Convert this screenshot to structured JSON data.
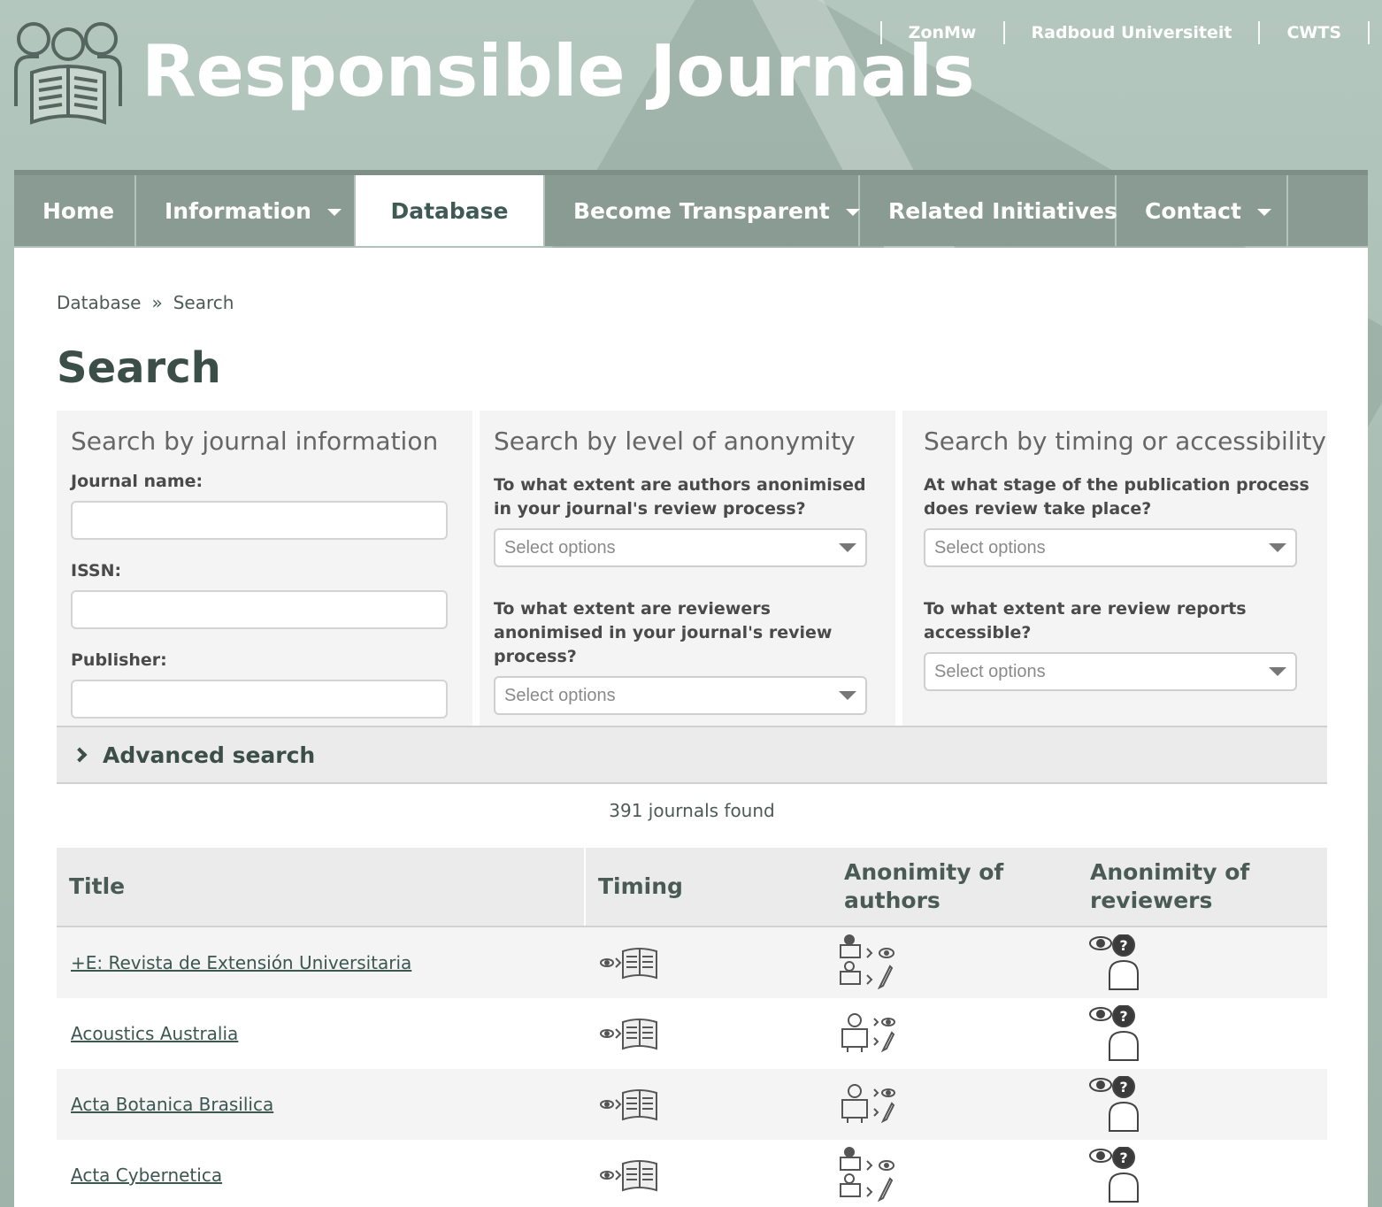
{
  "site": {
    "title": "Responsible Journals",
    "top_links": [
      "ZonMw",
      "Radboud Universiteit",
      "CWTS"
    ]
  },
  "nav": [
    {
      "label": "Home",
      "dropdown": false,
      "active": false
    },
    {
      "label": "Information",
      "dropdown": true,
      "active": false
    },
    {
      "label": "Database",
      "dropdown": false,
      "active": true
    },
    {
      "label": "Become Transparent",
      "dropdown": true,
      "active": false
    },
    {
      "label": "Related Initiatives",
      "dropdown": false,
      "active": false
    },
    {
      "label": "Contact",
      "dropdown": true,
      "active": false
    }
  ],
  "breadcrumb": {
    "items": [
      "Database",
      "Search"
    ],
    "separator": "»"
  },
  "page_title": "Search",
  "filters": {
    "journal": {
      "heading": "Search by journal information",
      "name_label": "Journal name:",
      "issn_label": "ISSN:",
      "publisher_label": "Publisher:"
    },
    "anonymity": {
      "heading": "Search by level of anonymity",
      "authors_label": "To what extent are authors anonimised in your journal's review process?",
      "authors_placeholder": "Select options",
      "reviewers_label": "To what extent are reviewers anonimised in your journal's review process?",
      "reviewers_placeholder": "Select options"
    },
    "timing": {
      "heading": "Search by timing or accessibility",
      "stage_label": "At what stage of the publication process does review take place?",
      "stage_placeholder": "Select options",
      "reports_label": "To what extent are review reports accessible?",
      "reports_placeholder": "Select options"
    }
  },
  "advanced_search": "Advanced search",
  "results_count": "391 journals found",
  "table": {
    "headers": [
      "Title",
      "Timing",
      "Anonimity of authors",
      "Anonimity of reviewers"
    ],
    "rows": [
      {
        "title": "+E: Revista de Extensión Universitaria",
        "timing_icon": "eye-before-publication-icon",
        "authors_icon": "author-known-to-reviewer-and-editor-icon",
        "reviewers_icon": "reviewer-anonymous-icon"
      },
      {
        "title": "Acoustics Australia",
        "timing_icon": "eye-before-publication-icon",
        "authors_icon": "author-anonymous-to-both-icon",
        "reviewers_icon": "reviewer-anonymous-icon"
      },
      {
        "title": "Acta Botanica Brasilica",
        "timing_icon": "eye-before-publication-icon",
        "authors_icon": "author-anonymous-to-both-icon",
        "reviewers_icon": "reviewer-anonymous-icon"
      },
      {
        "title": "Acta Cybernetica",
        "timing_icon": "eye-before-publication-icon",
        "authors_icon": "author-known-to-reviewer-and-editor-icon",
        "reviewers_icon": "reviewer-anonymous-icon"
      }
    ]
  }
}
